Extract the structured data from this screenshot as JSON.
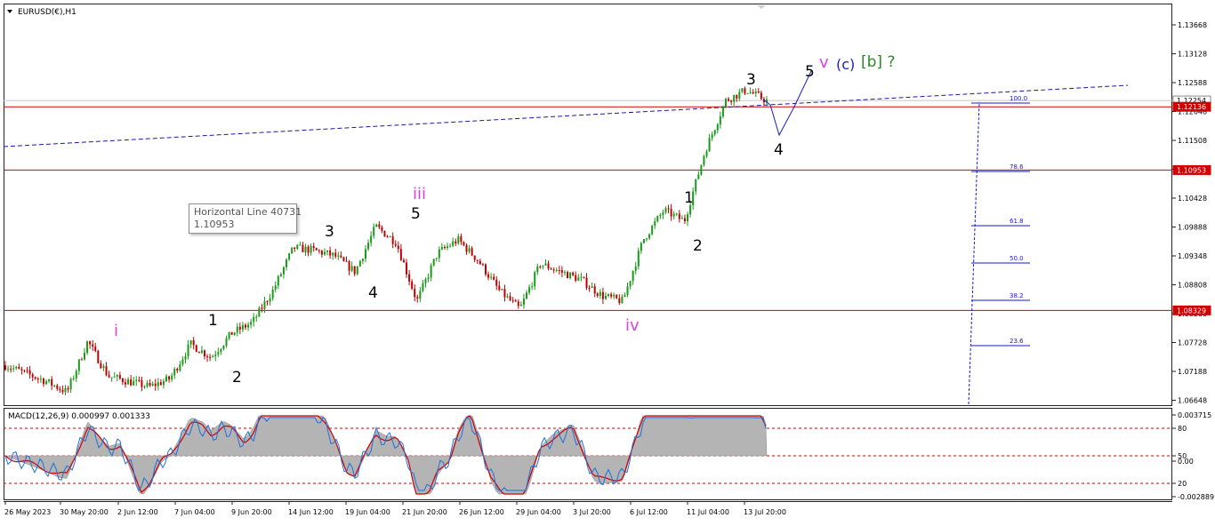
{
  "chart_window": {
    "symbol_title": "EURUSD(€),H1",
    "macd_title": "MACD(12,26,9) 0.000997 0.001333"
  },
  "tooltip": {
    "name": "Horizontal Line 40731",
    "value": "1.10953"
  },
  "colors": {
    "candle_bull": "#1a9a1a",
    "candle_bear": "#c00000",
    "trendline": "#1a1aa0",
    "hline": "#d00000",
    "wave_black": "#000000",
    "wave_magenta": "#e040e0",
    "wave_blue": "#1a1ad0",
    "wave_green": "#2a8a2a",
    "macd_hist": "#b4b4b4",
    "macd_signal": "#d00000",
    "macd_blue": "#1e6fe0"
  },
  "chart_data": [
    {
      "type": "candlestick",
      "title": "EURUSD(€),H1",
      "y_axis_ticks": [
        "1.13668",
        "1.13128",
        "1.12588",
        "1.12048",
        "1.11508",
        "1.10968",
        "1.10428",
        "1.09888",
        "1.09348",
        "1.08808",
        "1.08268",
        "1.07728",
        "1.07188",
        "1.06648"
      ],
      "price_tags": [
        {
          "value": "1.12254",
          "color": "#ffffff"
        },
        {
          "value": "1.12136",
          "color": "#d00000"
        },
        {
          "value": "1.10953",
          "color": "#d00000"
        },
        {
          "value": "1.08329",
          "color": "#d00000"
        }
      ],
      "horizontal_lines": [
        1.12136,
        1.10953,
        1.08329
      ],
      "x_axis_labels": [
        "26 May 2023",
        "30 May 20:00",
        "2 Jun 12:00",
        "7 Jun 04:00",
        "9 Jun 20:00",
        "14 Jun 12:00",
        "19 Jun 04:00",
        "21 Jun 20:00",
        "26 Jun 12:00",
        "29 Jun 04:00",
        "3 Jul 20:00",
        "6 Jul 12:00",
        "11 Jul 04:00",
        "13 Jul 20:00"
      ],
      "path_points": [
        [
          "26 May 2023",
          1.073
        ],
        [
          "29 May",
          1.0715
        ],
        [
          "30 May 20:00",
          1.07
        ],
        [
          "31 May",
          1.068
        ],
        [
          "1 Jun",
          1.0775
        ],
        [
          "2 Jun 12:00",
          1.071
        ],
        [
          "5 Jun",
          1.07
        ],
        [
          "6 Jun",
          1.069
        ],
        [
          "7 Jun 04:00",
          1.0705
        ],
        [
          "8 Jun",
          1.077
        ],
        [
          "9 Jun 20:00",
          1.0745
        ],
        [
          "12 Jun",
          1.079
        ],
        [
          "13 Jun",
          1.081
        ],
        [
          "14 Jun 12:00",
          1.087
        ],
        [
          "15 Jun",
          1.095
        ],
        [
          "16 Jun",
          1.0945
        ],
        [
          "19 Jun 04:00",
          1.0935
        ],
        [
          "20 Jun",
          1.0905
        ],
        [
          "21 Jun 20:00",
          1.099
        ],
        [
          "22 Jun",
          1.096
        ],
        [
          "23 Jun",
          1.085
        ],
        [
          "26 Jun 12:00",
          1.094
        ],
        [
          "27 Jun",
          1.0965
        ],
        [
          "28 Jun",
          1.0925
        ],
        [
          "29 Jun 04:00",
          1.087
        ],
        [
          "30 Jun",
          1.0835
        ],
        [
          "3 Jul 20:00",
          1.092
        ],
        [
          "4 Jul",
          1.0905
        ],
        [
          "5 Jul",
          1.089
        ],
        [
          "6 Jul 12:00",
          1.086
        ],
        [
          "7 Jul",
          1.085
        ],
        [
          "10 Jul",
          1.0965
        ],
        [
          "11 Jul 04:00",
          1.102
        ],
        [
          "12 Jul",
          1.1
        ],
        [
          "13 Jul",
          1.113
        ],
        [
          "13 Jul 20:00",
          1.1225
        ],
        [
          "14 Jul",
          1.1245
        ],
        [
          "14 Jul late",
          1.1225
        ]
      ],
      "wave_labels": [
        {
          "text": "i",
          "color": "magenta"
        },
        {
          "text": "1",
          "color": "black"
        },
        {
          "text": "2",
          "color": "black"
        },
        {
          "text": "3",
          "color": "black"
        },
        {
          "text": "4",
          "color": "black"
        },
        {
          "text": "iii",
          "color": "magenta"
        },
        {
          "text": "5",
          "color": "black"
        },
        {
          "text": "iv",
          "color": "magenta"
        },
        {
          "text": "1",
          "color": "black"
        },
        {
          "text": "2",
          "color": "black"
        },
        {
          "text": "3",
          "color": "black"
        },
        {
          "text": "4",
          "color": "black"
        },
        {
          "text": "5",
          "color": "black"
        },
        {
          "text": "v",
          "color": "magenta"
        },
        {
          "text": "(c)",
          "color": "blue"
        },
        {
          "text": "[b] ?",
          "color": "green"
        }
      ],
      "fib_levels": [
        "100.0",
        "78.6",
        "61.8",
        "50.0",
        "38.2",
        "23.6"
      ]
    },
    {
      "type": "line",
      "title": "MACD(12,26,9) 0.000997 0.001333",
      "y_axis_ticks": [
        "0.003715",
        "80",
        "50",
        "0.00",
        "20",
        "-0.002889"
      ],
      "levels": [
        80,
        50,
        20
      ]
    }
  ]
}
